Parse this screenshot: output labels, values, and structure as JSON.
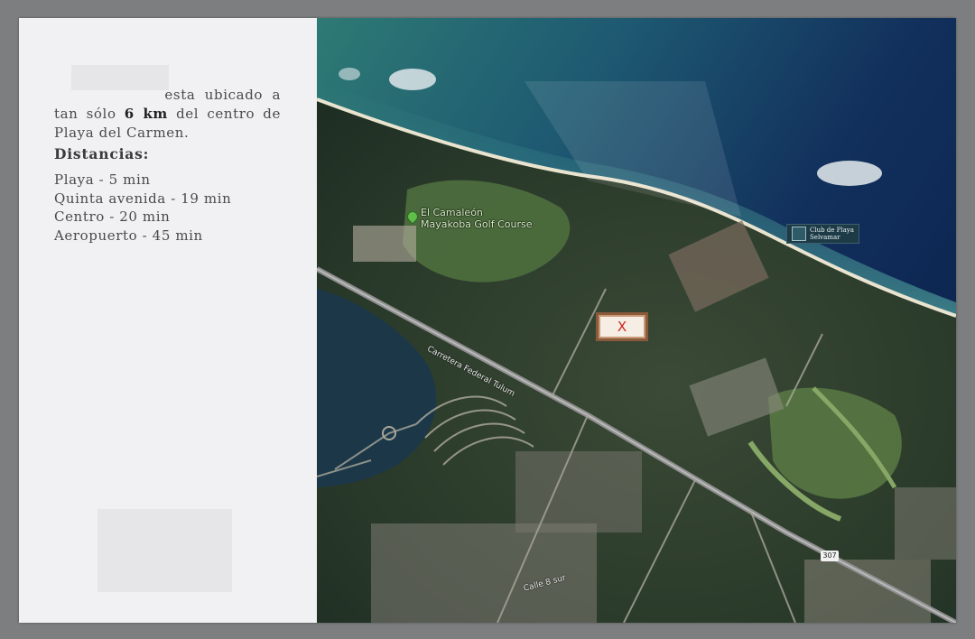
{
  "intro": {
    "text_a": "esta ubicado a tan sólo",
    "distance": "6 km",
    "text_b": "del centro de Playa del Carmen."
  },
  "distances": {
    "heading": "Distancias:",
    "items": [
      "Playa - 5 min",
      "Quinta avenida - 19 min",
      "Centro - 20 min",
      "Aeropuerto - 45 min"
    ]
  },
  "map": {
    "poi_golf": "El Camaleón\nMayakoba Golf Course",
    "club_label": "Club de Playa\nSelvamar",
    "marker": "X",
    "road_1": "Carretera Federal Tulum",
    "route_number": "307",
    "street_label": "Calle 8 sur"
  },
  "colors": {
    "marker_text": "#d2281e",
    "page_bg": "#f1f1f3"
  }
}
